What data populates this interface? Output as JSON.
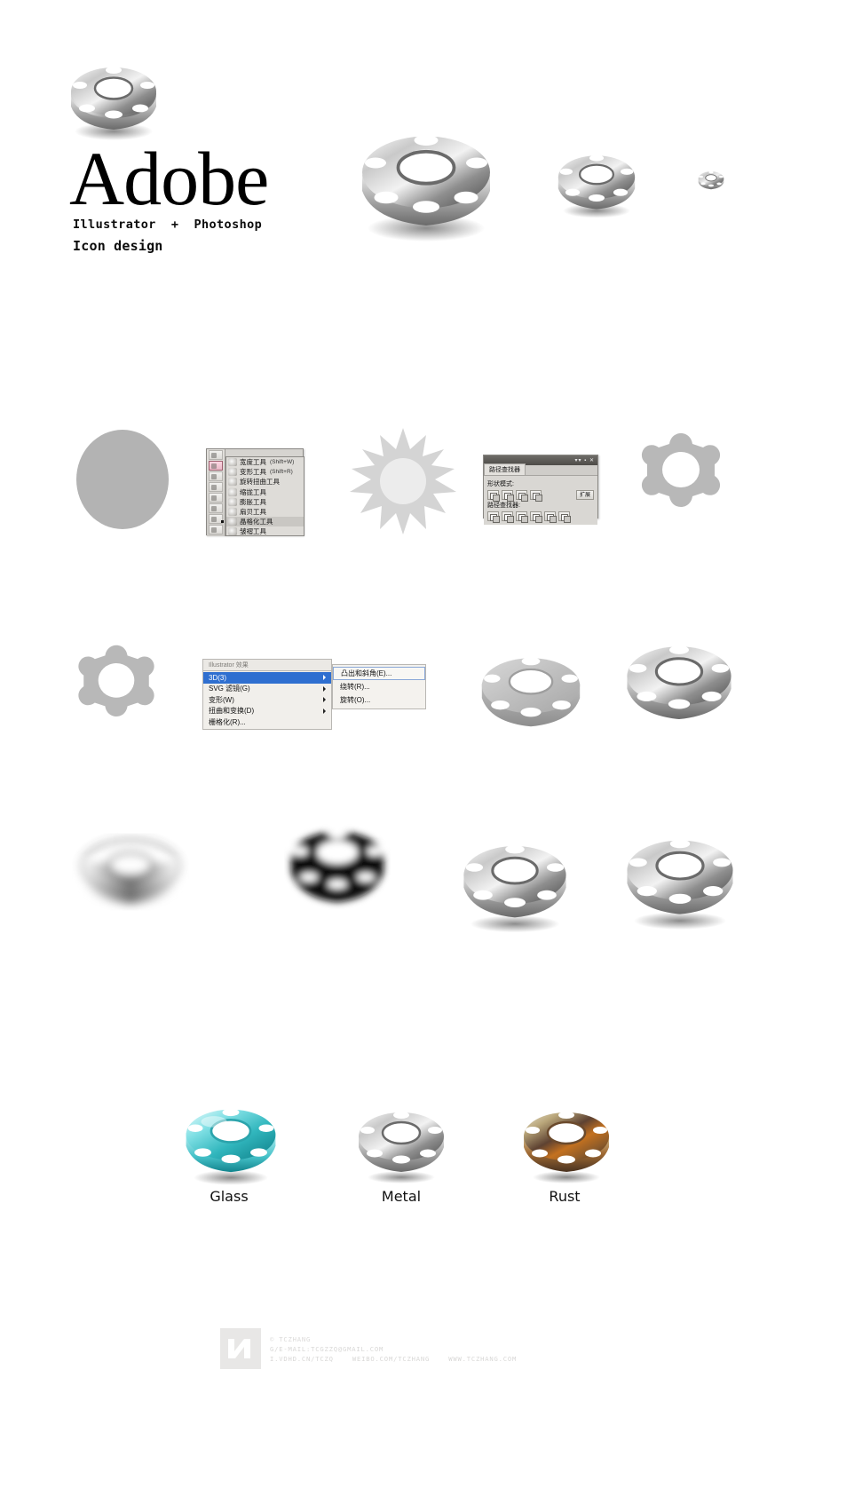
{
  "title_block": {
    "wordmark": "Adobe",
    "apps_line": "Illustrator  +  Photoshop",
    "role_line": "Icon design"
  },
  "hero": {
    "gear_large_label": "gear-3d-hero",
    "gear_sizes": [
      "128",
      "64",
      "32",
      "16"
    ]
  },
  "tool_flyout": {
    "panel_name": "Illustrator Tools flyout",
    "items": [
      {
        "label": "宽度工具",
        "shortcut": "(Shift+W)"
      },
      {
        "label": "变形工具",
        "shortcut": "(Shift+R)"
      },
      {
        "label": "旋转扭曲工具",
        "shortcut": ""
      },
      {
        "label": "缩拢工具",
        "shortcut": ""
      },
      {
        "label": "膨胀工具",
        "shortcut": ""
      },
      {
        "label": "扇贝工具",
        "shortcut": ""
      },
      {
        "label": "晶格化工具",
        "shortcut": ""
      },
      {
        "label": "皱褶工具",
        "shortcut": ""
      }
    ],
    "selected_index": 6
  },
  "pathfinder_panel": {
    "tab_label": "路径查找器",
    "shape_modes_label": "形状模式:",
    "pathfinders_label": "路径查找器:",
    "expand_label": "扩展",
    "titlebar_dots": "▾▾ ▪ ✕"
  },
  "effect_menu": {
    "header": "Illustrator 效果",
    "items": [
      {
        "label": "3D(3)",
        "has_submenu": true,
        "selected": true
      },
      {
        "label": "SVG 滤镜(G)",
        "has_submenu": true,
        "selected": false
      },
      {
        "label": "变形(W)",
        "has_submenu": true,
        "selected": false
      },
      {
        "label": "扭曲和变换(D)",
        "has_submenu": true,
        "selected": false
      },
      {
        "label": "栅格化(R)...",
        "has_submenu": false,
        "selected": false
      }
    ],
    "submenu_items": [
      "凸出和斜角(E)...",
      "绕转(R)...",
      "旋转(O)..."
    ]
  },
  "materials": {
    "labels": [
      "Glass",
      "Metal",
      "Rust"
    ],
    "colors": {
      "glass": "#3fc3c9",
      "metal": "#9a9a9a",
      "rust": "#a3743c"
    }
  },
  "watermark": {
    "line1": "© TCZHANG",
    "line2_a": "G/E-MAIL:TCGZZQ@GMAIL.COM",
    "line3_a": "I.VDHD.CN/TCZQ",
    "line3_b": "WEIBO.COM/TCZHANG",
    "line3_c": "WWW.TCZHANG.COM"
  },
  "palette": {
    "background": "#ffffff",
    "gear_flat_fill": "#b3b3b3",
    "gear_flat_fill_light": "#d9d9d9",
    "text": "#111111"
  }
}
